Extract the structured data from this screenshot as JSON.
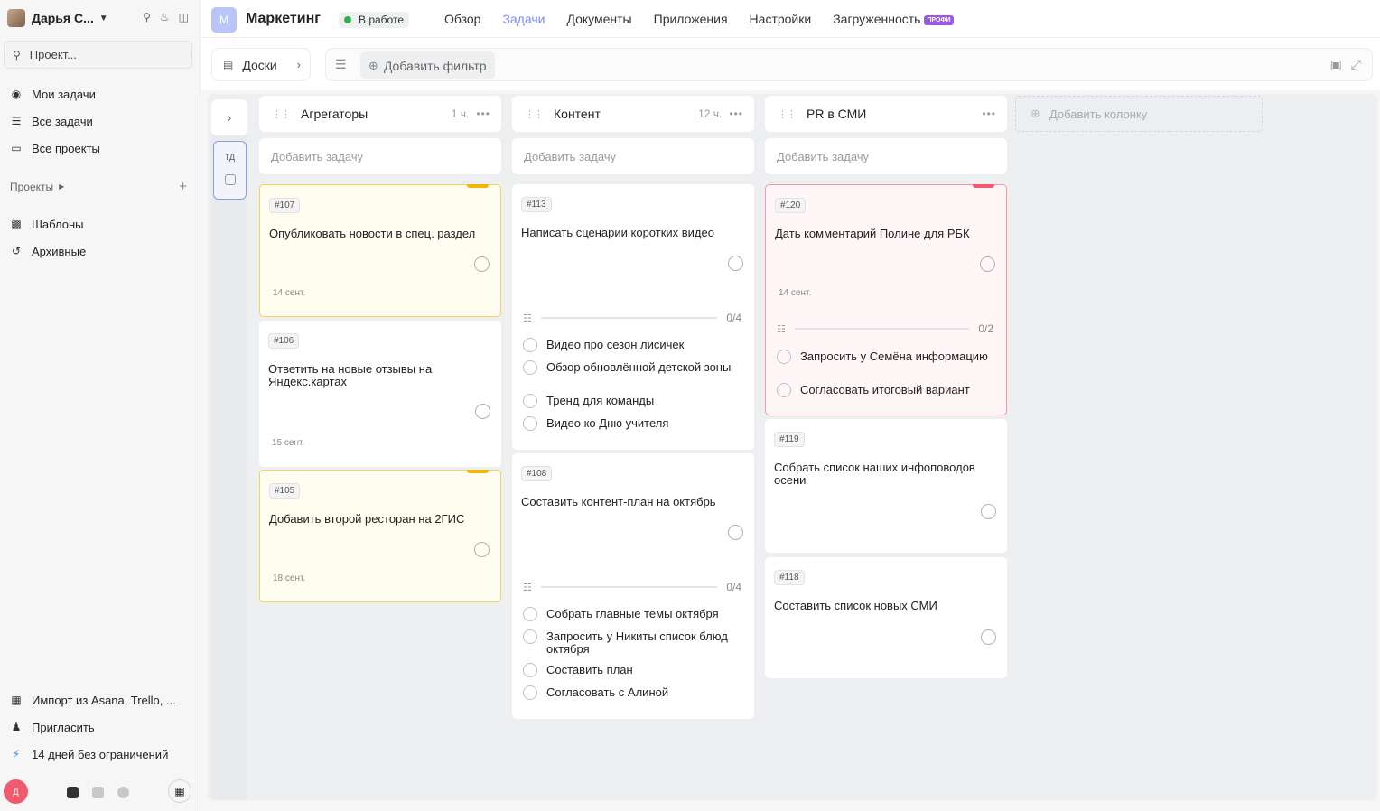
{
  "sidebar": {
    "user_name": "Дарья С...",
    "search_placeholder": "Проект...",
    "nav": [
      {
        "label": "Мои задачи",
        "icon": "my-tasks-icon"
      },
      {
        "label": "Все задачи",
        "icon": "all-tasks-icon"
      },
      {
        "label": "Все проекты",
        "icon": "folder-icon"
      }
    ],
    "projects_label": "Проекты",
    "nav2": [
      {
        "label": "Шаблоны",
        "icon": "templates-icon"
      },
      {
        "label": "Архивные",
        "icon": "archive-icon"
      }
    ],
    "bottom": [
      {
        "label": "Импорт из Asana, Trello, ...",
        "icon": "trello-icon"
      },
      {
        "label": "Пригласить",
        "icon": "invite-icon"
      },
      {
        "label": "14 дней без ограничений",
        "icon": "lightning-icon"
      }
    ],
    "avatar_letter": "Д"
  },
  "header": {
    "project_initial": "М",
    "project_title": "Маркетинг",
    "status": "В работе",
    "tabs": [
      "Обзор",
      "Задачи",
      "Документы",
      "Приложения",
      "Настройки",
      "Загруженность"
    ],
    "active_tab": "Задачи",
    "pro_badge": "ПРОФИ"
  },
  "toolbar": {
    "boards_label": "Доски",
    "add_filter_label": "Добавить фильтр"
  },
  "board": {
    "collapsed_label": "ТД",
    "add_task_label": "Добавить задачу",
    "add_column_label": "Добавить колонку",
    "columns": [
      {
        "name": "Агрегаторы",
        "hours": "1 ч."
      },
      {
        "name": "Контент",
        "hours": "12 ч."
      },
      {
        "name": "PR в СМИ",
        "hours": ""
      }
    ],
    "cards": {
      "c107": {
        "num": "#107",
        "title": "Опубликовать новости в спец. раздел",
        "date": "14 сент."
      },
      "c106": {
        "num": "#106",
        "title": "Ответить на новые отзывы на Яндекс.картах",
        "date": "15 сент."
      },
      "c105": {
        "num": "#105",
        "title": "Добавить второй ресторан на 2ГИС",
        "date": "18 сент."
      },
      "c113": {
        "num": "#113",
        "title": "Написать сценарии коротких видео",
        "progress": "0/4",
        "subtasks": [
          "Видео про сезон лисичек",
          "Обзор обновлённой детской зоны",
          "Тренд для команды",
          "Видео ко Дню учителя"
        ]
      },
      "c108": {
        "num": "#108",
        "title": "Составить контент-план на октябрь",
        "progress": "0/4",
        "subtasks": [
          "Собрать главные темы октября",
          "Запросить у Никиты список блюд октября",
          "Составить план",
          "Согласовать с Алиной"
        ]
      },
      "c120": {
        "num": "#120",
        "title": "Дать комментарий Полине для РБК",
        "date": "14 сент.",
        "progress": "0/2",
        "subtasks": [
          "Запросить у Семёна информацию",
          "Согласовать итоговый вариант"
        ]
      },
      "c119": {
        "num": "#119",
        "title": "Собрать список наших инфоповодов осени"
      },
      "c118": {
        "num": "#118",
        "title": "Составить список новых СМИ"
      }
    }
  },
  "colors": {
    "accent": "#7a8af0",
    "status_green": "#2bb24c",
    "yellow_flag": "#f2b705",
    "red_flag": "#ef5a6f",
    "pro": "#9b59e8"
  }
}
